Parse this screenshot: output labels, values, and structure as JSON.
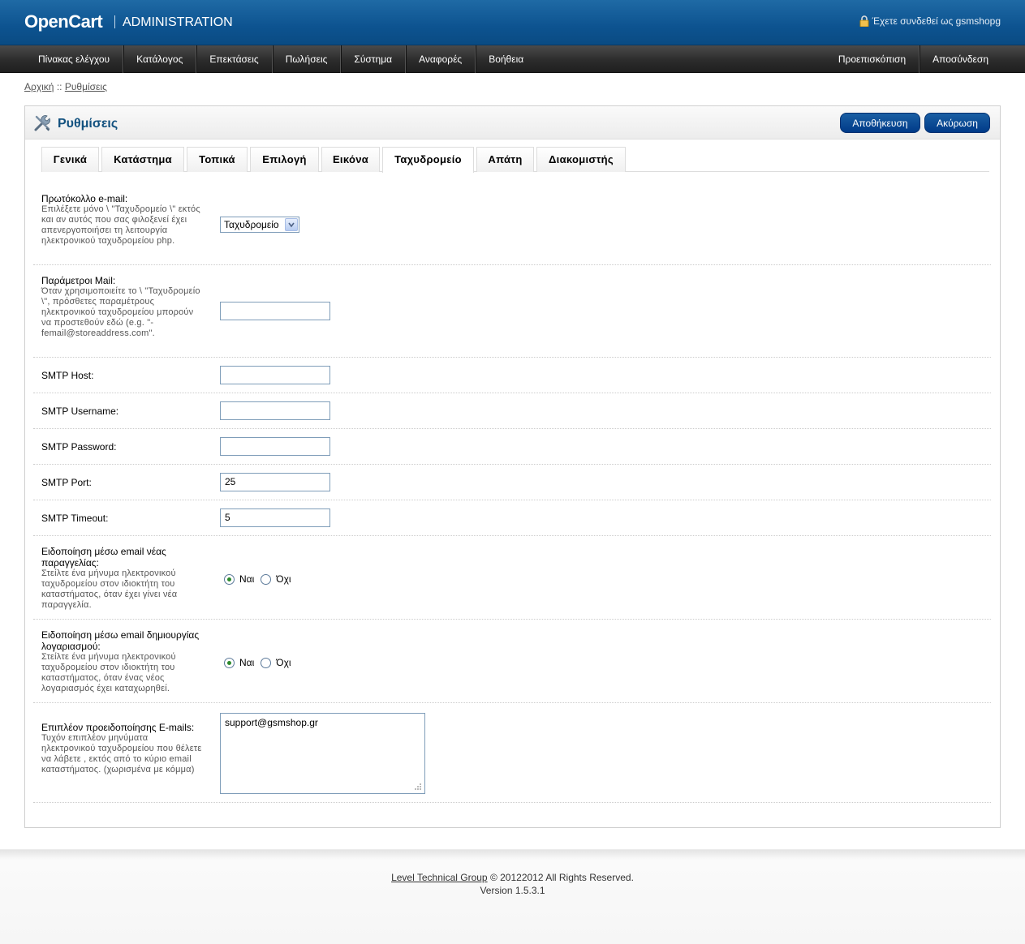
{
  "header": {
    "logo": "OpenCart",
    "subtitle": "ADMINISTRATION",
    "logged_in": "Έχετε συνδεθεί ως gsmshopg"
  },
  "menu": {
    "left": [
      "Πίνακας ελέγχου",
      "Κατάλογος",
      "Επεκτάσεις",
      "Πωλήσεις",
      "Σύστημα",
      "Αναφορές",
      "Βοήθεια"
    ],
    "right": [
      "Προεπισκόπιση",
      "Αποσύνδεση"
    ]
  },
  "breadcrumb": {
    "home": "Αρχική",
    "separator": "::",
    "current": "Ρυθμίσεις"
  },
  "heading": {
    "title": "Ρυθμίσεις",
    "save": "Αποθήκευση",
    "cancel": "Ακύρωση"
  },
  "tabs": [
    "Γενικά",
    "Κατάστημα",
    "Τοπικά",
    "Επιλογή",
    "Εικόνα",
    "Ταχυδρομείο",
    "Απάτη",
    "Διακομιστής"
  ],
  "active_tab": "Ταχυδρομείο",
  "form": {
    "protocol": {
      "label": "Πρωτόκολλο e-mail:",
      "help": "Επιλέξετε μόνο \\ \"Ταχυδρομείο \\\" εκτός και αν αυτός που σας φιλοξενεί έχει απενεργοποιήσει τη λειτουργία ηλεκτρονικού ταχυδρομείου php.",
      "value": "Ταχυδρομείο"
    },
    "mail_params": {
      "label": "Παράμετροι Mail:",
      "help": "Όταν χρησιμοποιείτε το \\ \"Ταχυδρομείο \\\", πρόσθετες παραμέτρους ηλεκτρονικού ταχυδρομείου μπορούν να προστεθούν εδώ (e.g. \"-femail@storeaddress.com\".",
      "value": ""
    },
    "smtp_host": {
      "label": "SMTP Host:",
      "value": ""
    },
    "smtp_username": {
      "label": "SMTP Username:",
      "value": ""
    },
    "smtp_password": {
      "label": "SMTP Password:",
      "value": ""
    },
    "smtp_port": {
      "label": "SMTP Port:",
      "value": "25"
    },
    "smtp_timeout": {
      "label": "SMTP Timeout:",
      "value": "5"
    },
    "alert_order": {
      "label": "Ειδοποίηση μέσω email νέας παραγγελίας:",
      "help": "Στείλτε ένα μήνυμα ηλεκτρονικού ταχυδρομείου στον ιδιοκτήτη του καταστήματος, όταν έχει γίνει νέα παραγγελία.",
      "yes": "Ναι",
      "no": "Όχι",
      "selected": "yes"
    },
    "alert_account": {
      "label": "Ειδοποίηση μέσω email δημιουργίας λογαριασμού:",
      "help": "Στείλτε ένα μήνυμα ηλεκτρονικού ταχυδρομείου στον ιδιοκτήτη του καταστήματος, όταν ένας νέος λογαριασμός έχει καταχωρηθεί.",
      "yes": "Ναι",
      "no": "Όχι",
      "selected": "yes"
    },
    "alert_emails": {
      "label": "Επιπλέον προειδοποίησης E-mails:",
      "help": "Τυχόν επιπλέον μηνύματα ηλεκτρονικού ταχυδρομείου που θέλετε να λάβετε , εκτός από το κύριο email καταστήματος. (χωρισμένα με κόμμα)",
      "value": "support@gsmshop.gr"
    }
  },
  "footer": {
    "link": "Level Technical Group",
    "rights": "© 20122012 All Rights Reserved.",
    "version": "Version 1.5.3.1"
  },
  "colors": {
    "header_blue": "#0d5390",
    "menu_dark": "#2c2c2c",
    "heading_text": "#12517f",
    "button_blue": "#003a88"
  }
}
